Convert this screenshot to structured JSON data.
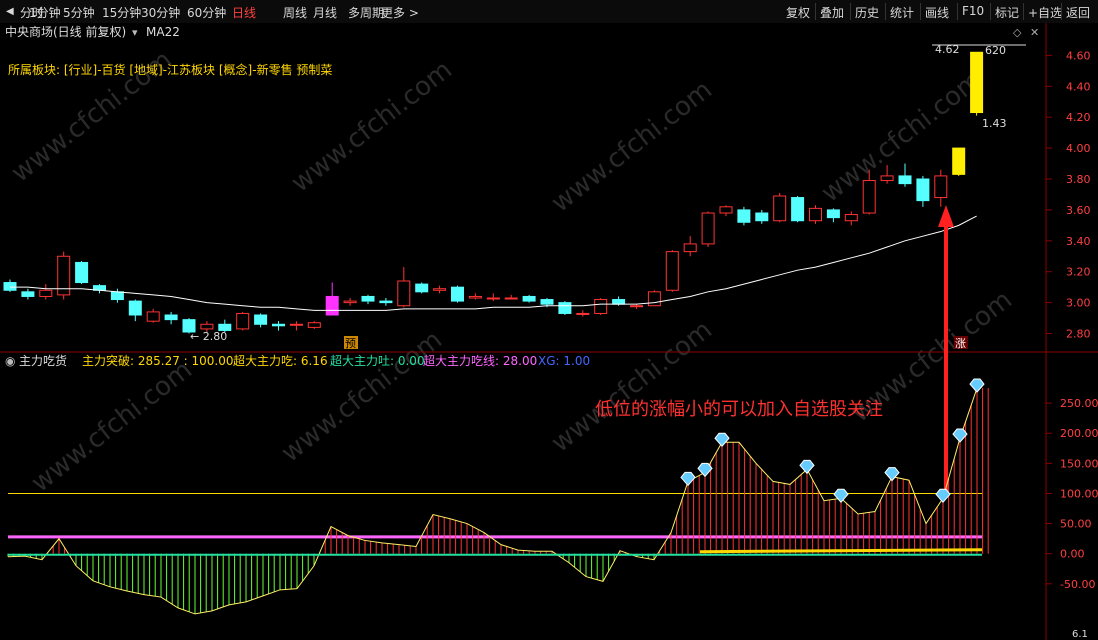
{
  "toolbar": {
    "left": [
      {
        "label": "分时"
      },
      {
        "label": "1分钟"
      },
      {
        "label": "5分钟"
      },
      {
        "label": "15分钟"
      },
      {
        "label": "30分钟"
      },
      {
        "label": "60分钟"
      },
      {
        "label": "日线",
        "active": true
      },
      {
        "label": "周线"
      },
      {
        "label": "月线"
      },
      {
        "label": "多周期"
      },
      {
        "label": "更多 >"
      }
    ],
    "right": [
      {
        "label": "复权"
      },
      {
        "label": "叠加"
      },
      {
        "label": "历史"
      },
      {
        "label": "统计"
      },
      {
        "label": "画线"
      },
      {
        "label": "F10"
      },
      {
        "label": "标记"
      },
      {
        "label": "+自选"
      },
      {
        "label": "返回"
      }
    ]
  },
  "header": {
    "title": "中央商场(日线 前复权)",
    "indicator": "MA22"
  },
  "sector_line": "所属板块: [行业]-百货 [地域]-江苏板块 [概念]-新零售 预制菜",
  "lower_header": {
    "name": "主力吃货",
    "items": [
      {
        "text": "主力突破: 285.27 : 100.00",
        "color": "#ffd700"
      },
      {
        "text": "超大主力吃: 6.16",
        "color": "#ffd700"
      },
      {
        "text": "超大主力吐: 0.00",
        "color": "#22e0a0"
      },
      {
        "text": "超大主力吃线: 28.00",
        "color": "#ff66ff"
      },
      {
        "text": "XG: 1.00",
        "color": "#4466ff"
      }
    ]
  },
  "annotation": "低位的涨幅小的可以加入自选股关注",
  "watermark": "www.cfchi.com",
  "labels": {
    "low": "← 2.80",
    "high": "4.62",
    "high_right": "620",
    "gap_ratio": "1.43",
    "yu": "预",
    "zhang": "涨",
    "bottom_right": "6.1"
  },
  "colors": {
    "up": "#ff3333",
    "down": "#55ffff",
    "limit": "#ffee00",
    "pre": "#ff33ff",
    "ma": "#ffffff",
    "frame": "#8a0000"
  },
  "chart_data": [
    {
      "type": "candlestick",
      "ylim": [
        2.7,
        4.68
      ],
      "yticks": [
        2.8,
        3.0,
        3.2,
        3.4,
        3.6,
        3.8,
        4.0,
        4.2,
        4.4,
        4.6
      ],
      "candles": [
        [
          3.13,
          3.08,
          3.15,
          3.07
        ],
        [
          3.07,
          3.04,
          3.09,
          3.02
        ],
        [
          3.04,
          3.08,
          3.12,
          3.02
        ],
        [
          3.05,
          3.3,
          3.33,
          3.02
        ],
        [
          3.26,
          3.13,
          3.27,
          3.12
        ],
        [
          3.11,
          3.08,
          3.12,
          3.06
        ],
        [
          3.07,
          3.02,
          3.09,
          3.0
        ],
        [
          3.01,
          2.92,
          3.02,
          2.88
        ],
        [
          2.88,
          2.94,
          2.96,
          2.87
        ],
        [
          2.92,
          2.89,
          2.94,
          2.86
        ],
        [
          2.89,
          2.81,
          2.9,
          2.8
        ],
        [
          2.83,
          2.86,
          2.88,
          2.81
        ],
        [
          2.86,
          2.82,
          2.89,
          2.81
        ],
        [
          2.83,
          2.93,
          2.94,
          2.82
        ],
        [
          2.92,
          2.86,
          2.93,
          2.84
        ],
        [
          2.86,
          2.85,
          2.88,
          2.82
        ],
        [
          2.86,
          2.86,
          2.88,
          2.82
        ],
        [
          2.84,
          2.87,
          2.88,
          2.83
        ],
        [
          2.92,
          3.04,
          3.13,
          2.92
        ],
        [
          3.0,
          3.01,
          3.03,
          2.98
        ],
        [
          3.04,
          3.01,
          3.05,
          2.99
        ],
        [
          3.01,
          3.0,
          3.03,
          2.98
        ],
        [
          2.98,
          3.14,
          3.23,
          2.97
        ],
        [
          3.12,
          3.07,
          3.13,
          3.06
        ],
        [
          3.08,
          3.09,
          3.11,
          3.06
        ],
        [
          3.1,
          3.01,
          3.11,
          3.0
        ],
        [
          3.03,
          3.04,
          3.06,
          3.02
        ],
        [
          3.03,
          3.03,
          3.06,
          3.01
        ],
        [
          3.03,
          3.03,
          3.05,
          3.02
        ],
        [
          3.04,
          3.01,
          3.05,
          3.0
        ],
        [
          3.02,
          2.99,
          3.03,
          2.97
        ],
        [
          3.0,
          2.93,
          3.01,
          2.92
        ],
        [
          2.93,
          2.93,
          2.95,
          2.91
        ],
        [
          2.93,
          3.02,
          3.03,
          2.92
        ],
        [
          3.02,
          2.99,
          3.04,
          2.98
        ],
        [
          2.98,
          2.98,
          2.99,
          2.96
        ],
        [
          2.98,
          3.07,
          3.08,
          2.98
        ],
        [
          3.08,
          3.33,
          3.34,
          3.07
        ],
        [
          3.33,
          3.38,
          3.43,
          3.3
        ],
        [
          3.38,
          3.58,
          3.59,
          3.36
        ],
        [
          3.58,
          3.62,
          3.63,
          3.56
        ],
        [
          3.6,
          3.52,
          3.62,
          3.5
        ],
        [
          3.58,
          3.53,
          3.6,
          3.51
        ],
        [
          3.53,
          3.69,
          3.71,
          3.52
        ],
        [
          3.68,
          3.53,
          3.69,
          3.52
        ],
        [
          3.53,
          3.61,
          3.63,
          3.51
        ],
        [
          3.6,
          3.55,
          3.61,
          3.52
        ],
        [
          3.53,
          3.57,
          3.59,
          3.5
        ],
        [
          3.58,
          3.79,
          3.86,
          3.57
        ],
        [
          3.79,
          3.82,
          3.89,
          3.77
        ],
        [
          3.82,
          3.77,
          3.9,
          3.75
        ],
        [
          3.8,
          3.66,
          3.82,
          3.62
        ],
        [
          3.68,
          3.82,
          3.86,
          3.62
        ],
        [
          3.83,
          4.0,
          4.0,
          3.82
        ],
        [
          4.23,
          4.62,
          4.62,
          4.21
        ]
      ],
      "ma": [
        3.1,
        3.1,
        3.09,
        3.09,
        3.09,
        3.08,
        3.07,
        3.06,
        3.05,
        3.04,
        3.02,
        3.0,
        2.99,
        2.98,
        2.97,
        2.97,
        2.96,
        2.95,
        2.95,
        2.95,
        2.95,
        2.95,
        2.96,
        2.96,
        2.96,
        2.96,
        2.96,
        2.97,
        2.97,
        2.97,
        2.98,
        2.98,
        2.98,
        2.99,
        2.99,
        2.99,
        3.0,
        3.02,
        3.04,
        3.07,
        3.09,
        3.12,
        3.15,
        3.18,
        3.21,
        3.23,
        3.26,
        3.29,
        3.32,
        3.36,
        3.4,
        3.43,
        3.46,
        3.5,
        3.56
      ]
    },
    {
      "type": "bar",
      "name": "主力吃货",
      "ylim": [
        -135,
        300
      ],
      "yticks": [
        -50,
        0,
        50,
        100,
        150,
        200,
        250
      ],
      "ref_lines": [
        {
          "value": 100,
          "color": "#ffd700"
        },
        {
          "value": 28,
          "color": "#ff66ff"
        }
      ],
      "values": [
        -5,
        -4,
        -10,
        25,
        -20,
        -45,
        -55,
        -62,
        -68,
        -72,
        -90,
        -100,
        -95,
        -85,
        -80,
        -70,
        -60,
        -58,
        -20,
        45,
        30,
        22,
        18,
        15,
        12,
        65,
        58,
        50,
        35,
        15,
        6,
        4,
        4,
        -15,
        -38,
        -46,
        5,
        -5,
        -10,
        35,
        120,
        135,
        185,
        185,
        150,
        120,
        115,
        140,
        88,
        92,
        66,
        70,
        128,
        122,
        50,
        92,
        192,
        275
      ],
      "diamonds": [
        40,
        41,
        42,
        47,
        49,
        52,
        55,
        56,
        57
      ]
    }
  ]
}
